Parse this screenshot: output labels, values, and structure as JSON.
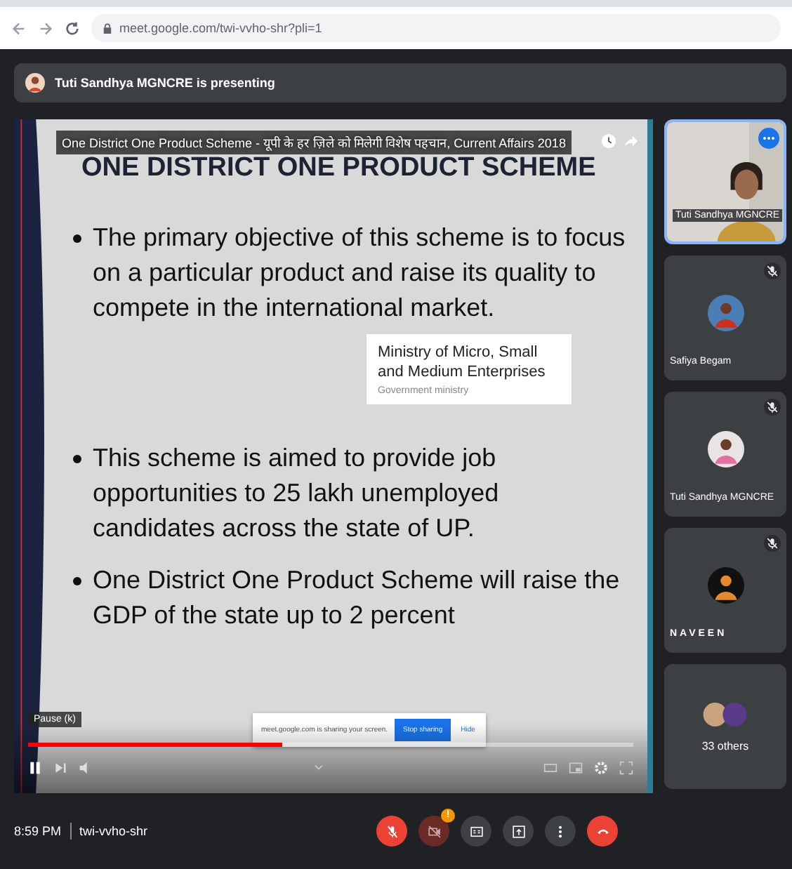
{
  "browser": {
    "url": "meet.google.com/twi-vvho-shr?pli=1"
  },
  "presenting": {
    "text": "Tuti Sandhya MGNCRE is presenting"
  },
  "video": {
    "title_parts": [
      "One District One Product Scheme - यूपी के हर ज़िले को मिलेगी विशेष पहचान",
      ", Current Affairs 2018"
    ],
    "heading": "ONE DISTRICT ONE PRODUCT SCHEME",
    "bullets": [
      "The primary objective of this scheme is to focus on a particular product and raise its quality to compete in the international market.",
      "This scheme is aimed to provide job opportunities to 25 lakh unemployed candidates across the state of UP.",
      "One District One Product Scheme will raise the GDP of the state up to 2 percent"
    ],
    "info_card": {
      "title": "Ministry of Micro, Small and Medium Enterprises",
      "subtitle": "Government ministry"
    },
    "tooltip": "Pause (k)",
    "playing": true,
    "progress": {
      "level": 0.42
    }
  },
  "share_notice": {
    "text": "meet.google.com is sharing your screen.",
    "stop_button": "Stop sharing",
    "hide_button": "Hide"
  },
  "participants": [
    {
      "kind": "video",
      "name": "Tuti Sandhya MGNCRE",
      "selected": true,
      "muted": false
    },
    {
      "kind": "avatar",
      "name": "Safiya Begam",
      "selected": false,
      "muted": true
    },
    {
      "kind": "avatar",
      "name": "Tuti Sandhya MGNCRE",
      "selected": false,
      "muted": true
    },
    {
      "kind": "avatar",
      "name": "NAVEEN",
      "selected": false,
      "muted": true
    },
    {
      "kind": "others",
      "name": "33 others",
      "selected": false,
      "muted": false
    }
  ],
  "bottom": {
    "time": "8:59 PM",
    "meeting_code": "twi-vvho-shr",
    "mic_on": false,
    "camera_on": false,
    "camera_alert": "!"
  }
}
